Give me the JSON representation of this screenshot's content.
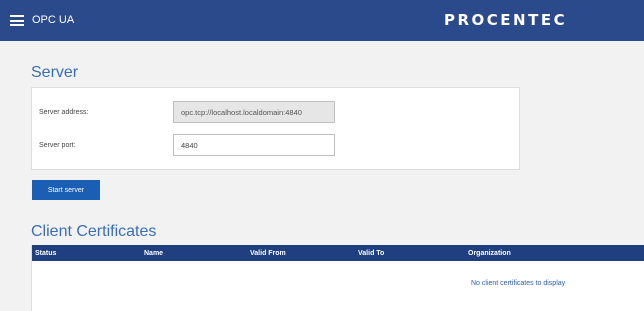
{
  "header": {
    "menu_icon": "hamburger-menu-icon",
    "app_title": "OPC UA",
    "brand": "PROCENTEC",
    "background_color": "#2b4a8b"
  },
  "server": {
    "title": "Server",
    "address_label": "Server address:",
    "address_value": "opc.tcp://localhost.localdomain:4840",
    "port_label": "Server port:",
    "port_value": "4840",
    "start_button_label": "Start server"
  },
  "certificates": {
    "title": "Client Certificates",
    "columns": [
      "Status",
      "Name",
      "Valid From",
      "Valid To",
      "Organization"
    ],
    "empty_message": "No client certificates to display",
    "header_color": "#1f3f80"
  }
}
